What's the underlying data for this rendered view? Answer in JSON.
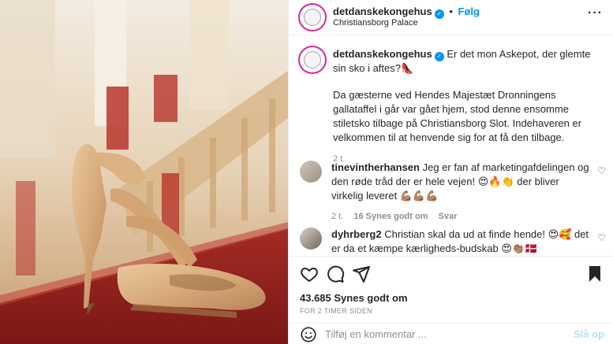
{
  "header": {
    "username": "detdanskekongehus",
    "follow_label": "Følg",
    "location": "Christiansborg Palace",
    "separator": "•",
    "more": "···"
  },
  "caption": {
    "username": "detdanskekongehus",
    "line1": "Er det mon Askepot, der glemte sin sko i aftes?👠",
    "paragraph": "Da gæsterne ved Hendes Majestæt Dronningens gallataffel i går var gået hjem, stod denne ensomme stiletsko tilbage på Christiansborg Slot. Indehaveren er velkommen til at henvende sig for at få den tilbage.",
    "age": "2 t."
  },
  "comments": [
    {
      "username": "tinevintherhansen",
      "text": "Jeg er fan af marketingafdelingen og den røde tråd der er hele vejen! 😍🔥👏 der bliver virkelig leveret 💪🏽💪🏽💪🏽",
      "age": "2 t.",
      "likes": "16 Synes godt om",
      "reply": "Svar"
    },
    {
      "username": "dyhrberg2",
      "text": "Christian skal da ud at finde hende! 😍🥰 det er da et kæmpe kærligheds-budskab 😍👏🏽🇩🇰"
    }
  ],
  "footer": {
    "likes": "43.685 Synes godt om",
    "time": "FOR 2 TIMER SIDEN",
    "comment_placeholder": "Tilføj en kommentar ...",
    "post_label": "Slå op"
  },
  "colors": {
    "accent": "#0095f6",
    "text": "#262626",
    "muted": "#8e8e8e",
    "carpet": "#9b2420"
  },
  "icons": [
    "more-options-icon",
    "verified-icon",
    "heart-icon",
    "comment-icon",
    "share-icon",
    "bookmark-icon",
    "emoji-icon"
  ]
}
